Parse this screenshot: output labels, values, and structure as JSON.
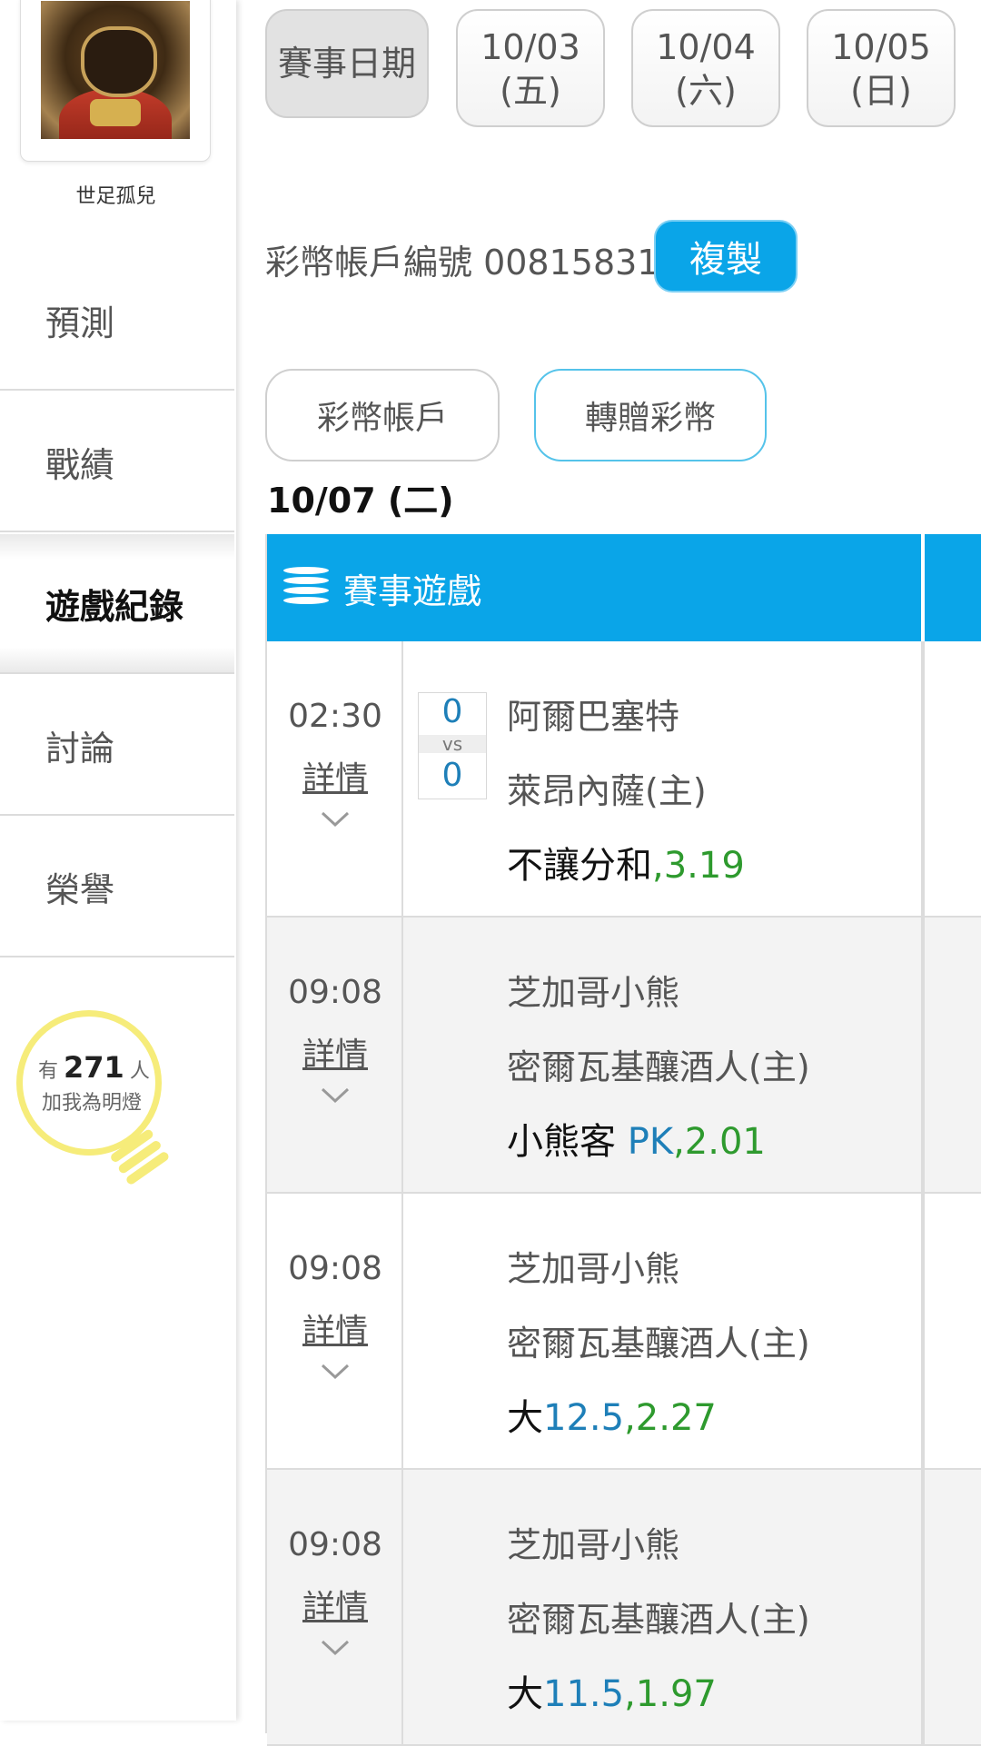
{
  "sidebar": {
    "username": "世足孤兒",
    "nav": [
      {
        "label": "預測"
      },
      {
        "label": "戰績"
      },
      {
        "label": "遊戲紀錄"
      },
      {
        "label": "討論"
      },
      {
        "label": "榮譽"
      }
    ],
    "fans": {
      "prefix": "有",
      "count": "271",
      "suffix": "人",
      "line2": "加我為明燈"
    }
  },
  "dates": {
    "label": "賽事日期",
    "items": [
      {
        "date": "10/03",
        "weekday": "(五)"
      },
      {
        "date": "10/04",
        "weekday": "(六)"
      },
      {
        "date": "10/05",
        "weekday": "(日)"
      }
    ]
  },
  "account": {
    "label": "彩幣帳戶編號 00815831",
    "copy": "複製"
  },
  "buttons": {
    "wallet": "彩幣帳戶",
    "gift": "轉贈彩幣"
  },
  "section_date": "10/07 (二)",
  "table": {
    "header": "賽事遊戲",
    "detail_label": "詳情",
    "rows": [
      {
        "time": "02:30",
        "score_away": "0",
        "vs": "vs",
        "score_home": "0",
        "team_a": "阿爾巴塞特",
        "team_b": "萊昂內薩(主)",
        "pick": "不讓分和",
        "line": "",
        "odds": ",3.19"
      },
      {
        "time": "09:08",
        "team_a": "芝加哥小熊",
        "team_b": "密爾瓦基釀酒人(主)",
        "pick": "小熊客 ",
        "line": "PK",
        "odds": ",2.01"
      },
      {
        "time": "09:08",
        "team_a": "芝加哥小熊",
        "team_b": "密爾瓦基釀酒人(主)",
        "pick": "大",
        "line": "12.5",
        "odds": ",2.27"
      },
      {
        "time": "09:08",
        "team_a": "芝加哥小熊",
        "team_b": "密爾瓦基釀酒人(主)",
        "pick": "大",
        "line": "11.5",
        "odds": ",1.97"
      }
    ]
  },
  "colors": {
    "accent": "#0aa5e8",
    "line": "#1e7fb8",
    "odds": "#2e9a2e",
    "bulb": "#f6ec7a"
  }
}
